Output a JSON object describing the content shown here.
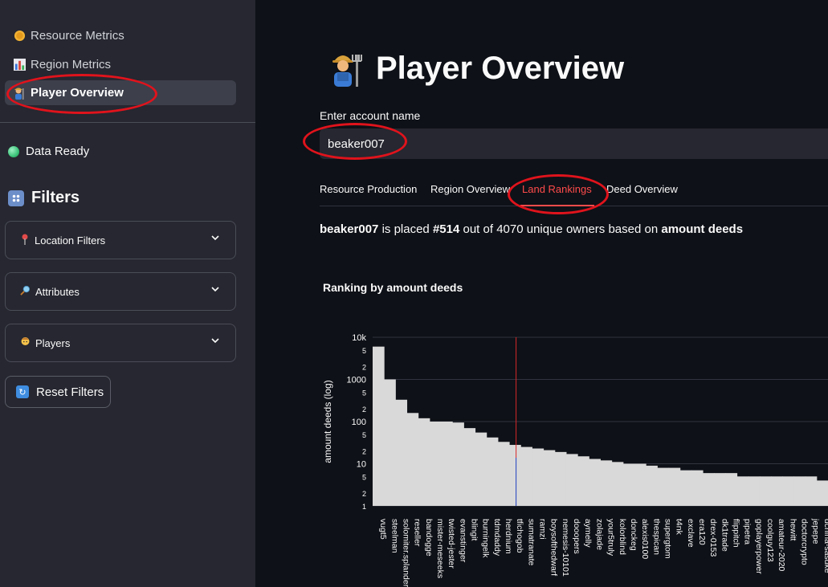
{
  "sidebar": {
    "nav": [
      {
        "label": "Resource Metrics",
        "icon": "coin-icon"
      },
      {
        "label": "Region Metrics",
        "icon": "bar-chart-icon"
      },
      {
        "label": "Player Overview",
        "icon": "farmer-icon",
        "active": true
      }
    ],
    "status": "Data Ready",
    "filters_title": "Filters",
    "expanders": [
      {
        "label": "Location Filters",
        "icon": "pin-icon"
      },
      {
        "label": "Attributes",
        "icon": "magnifier-icon"
      },
      {
        "label": "Players",
        "icon": "person-icon"
      }
    ],
    "reset_label": "Reset Filters"
  },
  "main": {
    "title": "Player Overview",
    "input_label": "Enter account name",
    "input_value": "beaker007",
    "tabs": [
      {
        "label": "Resource Production"
      },
      {
        "label": "Region Overview"
      },
      {
        "label": "Land Rankings",
        "active": true
      },
      {
        "label": "Deed Overview"
      }
    ],
    "summary": {
      "account": "beaker007",
      "text1": " is placed ",
      "rank": "#514",
      "text2": " out of 4070 unique owners based on ",
      "metric": "amount deeds"
    },
    "chart_title": "Ranking by amount deeds"
  },
  "colors": {
    "accent": "#ff4b4b",
    "annotation": "#e0131c",
    "bar": "#d9d9d9",
    "highlight_line": "#d62728",
    "highlight_line_bottom": "#1f3fbf"
  },
  "chart_data": {
    "type": "bar",
    "title": "Ranking by amount deeds",
    "ylabel": "amount deeds (log)",
    "xlabel": "",
    "yscale": "log",
    "ylim": [
      1,
      10000
    ],
    "y_tick_labels": [
      "10k",
      "5",
      "2",
      "1000",
      "5",
      "2",
      "100",
      "5",
      "2",
      "10",
      "5",
      "2",
      "1"
    ],
    "highlight": {
      "name": "tfichogob",
      "rank": 514
    },
    "categories": [
      "vugt5",
      "steelman",
      "solomiter.splander",
      "reseller",
      "bandogge",
      "mister-meseeks",
      "twisted-jester",
      "evanstinger",
      "blingit",
      "burningelk",
      "tdmdaddy",
      "herdnium",
      "tfichogob",
      "sumatranate",
      "ramzi",
      "boysofthedwarf",
      "nemesis-10101",
      "dooopers",
      "aymelly",
      "zolajade",
      "your5truly",
      "kolorblind",
      "donckeg",
      "alexis0100",
      "thespican",
      "supergtom",
      "t4nk",
      "exclave",
      "era120",
      "drex-0153",
      "dk1trade",
      "flippitch",
      "pipetra",
      "goplayerpower",
      "coolguy123",
      "amateur-2020",
      "hewitt",
      "doctorcrypto",
      "jepepe",
      "uchiha-sasuke"
    ],
    "values": [
      6000,
      1000,
      330,
      160,
      120,
      100,
      100,
      95,
      70,
      55,
      42,
      33,
      28,
      25,
      23,
      21,
      19,
      17,
      15,
      13,
      12,
      11,
      10,
      10,
      9,
      8,
      8,
      7,
      7,
      6,
      6,
      6,
      5,
      5,
      5,
      5,
      5,
      5,
      5,
      4
    ]
  }
}
